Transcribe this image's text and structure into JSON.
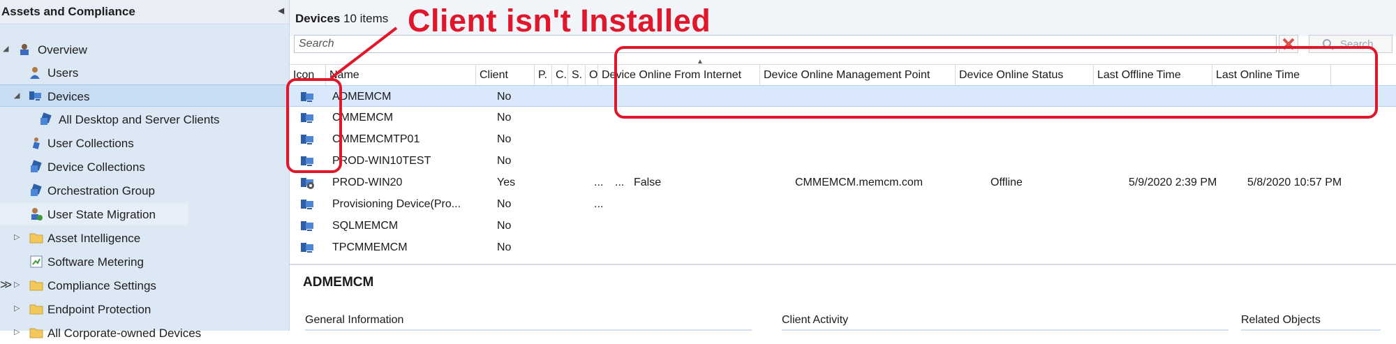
{
  "nav": {
    "title": "Assets and Compliance",
    "items": [
      {
        "label": "Overview"
      },
      {
        "label": "Users"
      },
      {
        "label": "Devices"
      },
      {
        "label": "All Desktop and Server Clients"
      },
      {
        "label": "User Collections"
      },
      {
        "label": "Device Collections"
      },
      {
        "label": "Orchestration Group"
      },
      {
        "label": "User State Migration"
      },
      {
        "label": "Asset Intelligence"
      },
      {
        "label": "Software Metering"
      },
      {
        "label": "Compliance Settings"
      },
      {
        "label": "Endpoint Protection"
      },
      {
        "label": "All Corporate-owned Devices"
      }
    ]
  },
  "main": {
    "title": "Devices",
    "count": "10 items",
    "search_placeholder": "Search",
    "search_button": "Search"
  },
  "grid": {
    "columns": [
      "Icon",
      "Name",
      "Client",
      "P.",
      "C.",
      "S.",
      "O.",
      "Device Online From Internet",
      "Device Online Management Point",
      "Device Online Status",
      "Last Offline Time",
      "Last Online Time"
    ],
    "rows": [
      {
        "name": "ADMEMCM",
        "client": "No",
        "s": "",
        "o": "",
        "internet": "",
        "mp": "",
        "status": "",
        "offline": "",
        "online": ""
      },
      {
        "name": "CMMEMCM",
        "client": "No",
        "s": "",
        "o": "",
        "internet": "",
        "mp": "",
        "status": "",
        "offline": "",
        "online": ""
      },
      {
        "name": "CMMEMCMTP01",
        "client": "No",
        "s": "",
        "o": "",
        "internet": "",
        "mp": "",
        "status": "",
        "offline": "",
        "online": ""
      },
      {
        "name": "PROD-WIN10TEST",
        "client": "No",
        "s": "",
        "o": "",
        "internet": "",
        "mp": "",
        "status": "",
        "offline": "",
        "online": ""
      },
      {
        "name": "PROD-WIN20",
        "client": "Yes",
        "s": "...",
        "o": "...",
        "internet": "False",
        "mp": "CMMEMCM.memcm.com",
        "status": "Offline",
        "offline": "5/9/2020 2:39 PM",
        "online": "5/8/2020 10:57 PM"
      },
      {
        "name": "Provisioning Device(Pro...",
        "client": "No",
        "s": "...",
        "o": "",
        "internet": "",
        "mp": "",
        "status": "",
        "offline": "",
        "online": ""
      },
      {
        "name": "SQLMEMCM",
        "client": "No",
        "s": "",
        "o": "",
        "internet": "",
        "mp": "",
        "status": "",
        "offline": "",
        "online": ""
      },
      {
        "name": "TPCMMEMCM",
        "client": "No",
        "s": "",
        "o": "",
        "internet": "",
        "mp": "",
        "status": "",
        "offline": "",
        "online": ""
      }
    ]
  },
  "details": {
    "title": "ADMEMCM",
    "sections": [
      "General Information",
      "Client Activity",
      "Related Objects"
    ]
  },
  "annotation": {
    "text": "Client isn't Installed",
    "color": "#e0162b"
  },
  "colors": {
    "nav_bg": "#dde8f5",
    "selection": "#d9e8fb"
  }
}
